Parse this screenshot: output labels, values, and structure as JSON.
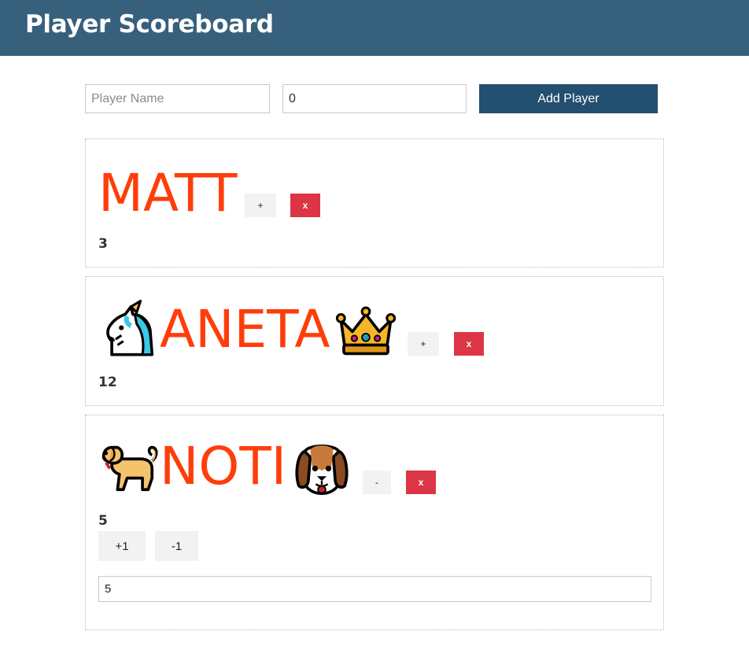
{
  "header": {
    "title": "Player Scoreboard"
  },
  "form": {
    "name_placeholder": "Player Name",
    "score_value": "0",
    "add_label": "Add Player"
  },
  "players": [
    {
      "name": "MATT",
      "score": "3",
      "prefix_emoji": "",
      "suffix_emoji": "",
      "toggle_label": "+",
      "remove_label": "x"
    },
    {
      "name": "ANETA",
      "score": "12",
      "prefix_emoji": "unicorn-icon",
      "suffix_emoji": "crown-icon",
      "toggle_label": "+",
      "remove_label": "x"
    },
    {
      "name": "NOTI",
      "score": "5",
      "prefix_emoji": "dog-icon",
      "suffix_emoji": "dog-face-icon",
      "toggle_label": "-",
      "remove_label": "x",
      "increment_label": "+1",
      "decrement_label": "-1",
      "score_input_value": "5"
    }
  ],
  "colors": {
    "header_bg": "#37607d",
    "add_button": "#234f71",
    "name_color": "#ff3d0a",
    "remove_button": "#dc3545"
  }
}
